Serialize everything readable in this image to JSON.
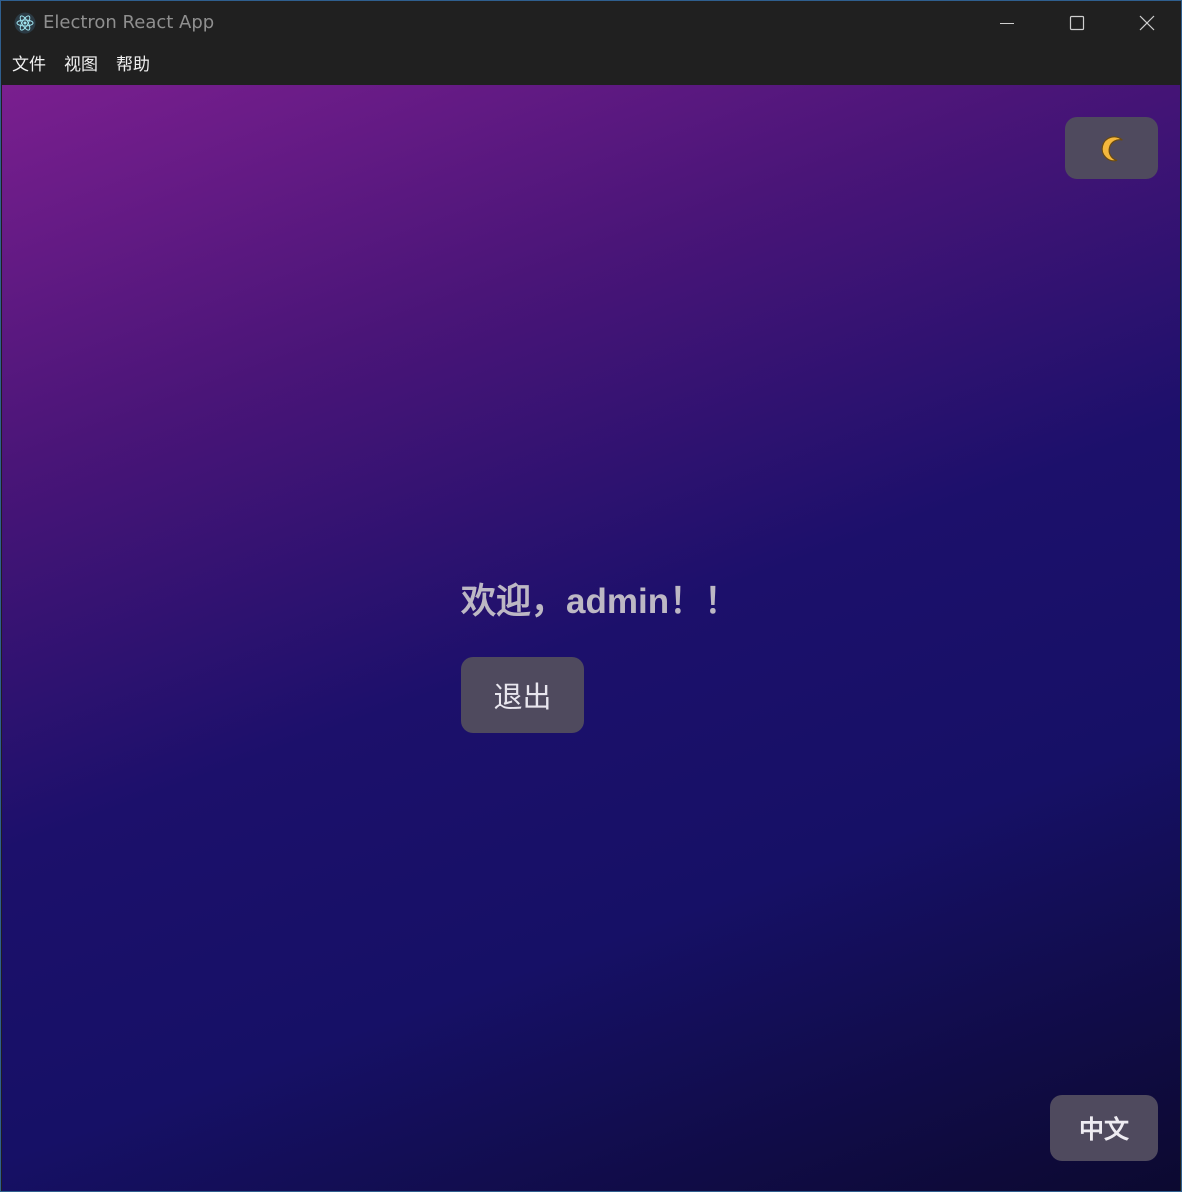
{
  "window": {
    "title": "Electron React App",
    "app_icon": "electron-atom-icon",
    "controls": {
      "minimize_icon": "minimize-icon",
      "maximize_icon": "maximize-icon",
      "close_icon": "close-icon"
    }
  },
  "menubar": {
    "items": [
      {
        "label": "文件"
      },
      {
        "label": "视图"
      },
      {
        "label": "帮助"
      }
    ]
  },
  "main": {
    "theme_toggle_icon": "moon-icon",
    "welcome_text": "欢迎，admin！！",
    "logout_label": "退出",
    "language_label": "中文"
  },
  "colors": {
    "gradient_top": "#7a1f8f",
    "gradient_mid": "#1c106b",
    "gradient_bottom": "#0c0930",
    "button_bg": "#4f4a5e",
    "welcome_text": "#bdb8c4"
  }
}
